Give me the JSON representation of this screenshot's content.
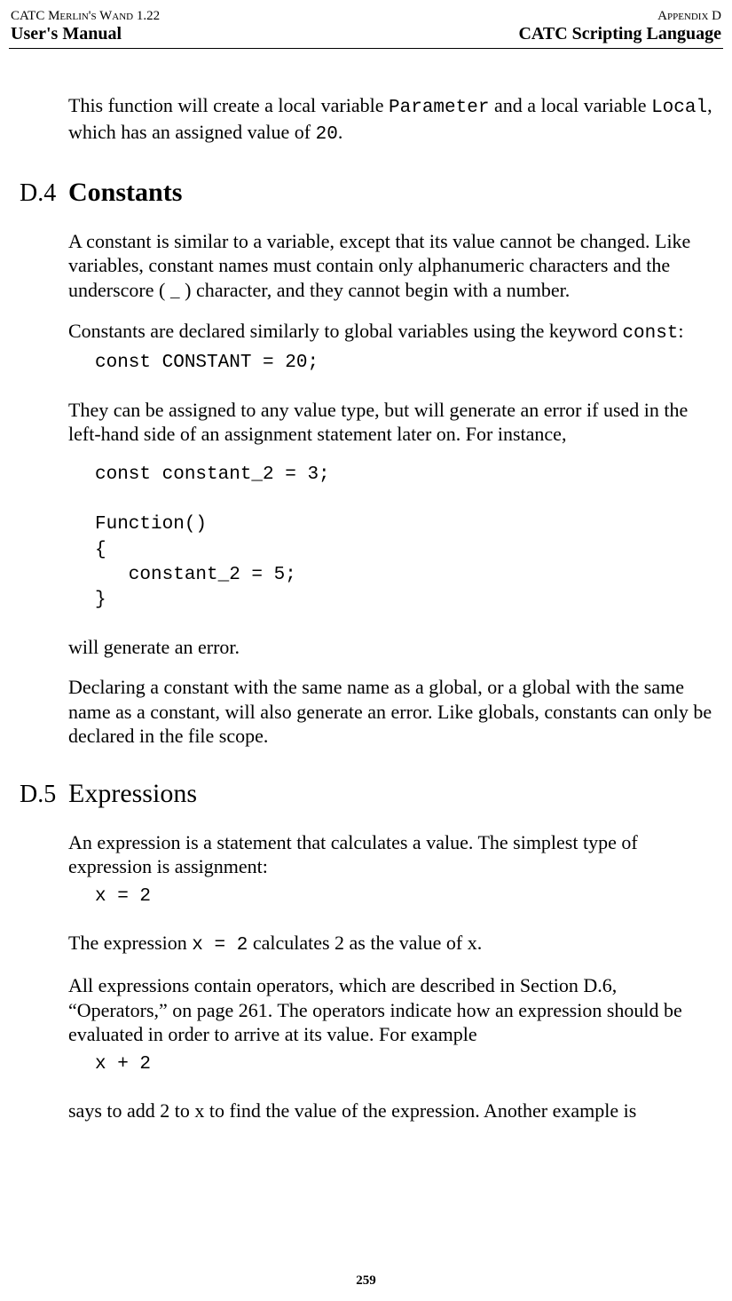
{
  "header": {
    "top_left": "CATC Merlin's Wand 1.22",
    "top_right": "Appendix D",
    "bottom_left": "User's Manual",
    "bottom_right": "CATC Scripting Language"
  },
  "intro": {
    "p1_a": "This function will create a local variable ",
    "p1_code1": "Parameter",
    "p1_b": " and a local variable ",
    "p1_code2": "Local",
    "p1_c": ", which has an assigned value of ",
    "p1_code3": "20",
    "p1_d": "."
  },
  "d4": {
    "number": "D.4",
    "title": "Constants",
    "p1_a": "A constant is similar to a variable, except that its value cannot be changed. Like variables, constant names must contain only alphanumeric characters and the underscore ( ",
    "p1_under": "_",
    "p1_b": " ) character, and they cannot begin with a number.",
    "p2_a": "Constants are declared similarly to global variables using the keyword ",
    "p2_code": "const",
    "p2_b": ":",
    "code1": "const CONSTANT = 20;",
    "p3": "They can be assigned to any value type, but will generate an error if used in the left-hand side of an assignment statement later on. For instance,",
    "code2": "const constant_2 = 3;\n\nFunction()\n{\n   constant_2 = 5;\n}",
    "p4": "will generate an error.",
    "p5": "Declaring a constant with the same name as a global, or a global with the same name as a constant, will also generate an error. Like globals, constants can only be declared in the file scope."
  },
  "d5": {
    "number": "D.5",
    "title": "Expressions",
    "p1": "An expression is a statement that calculates a value. The simplest type of expression is assignment:",
    "code1": "x = 2",
    "p2_a": "The expression ",
    "p2_code": "x = 2",
    "p2_b": " calculates 2 as the value of x.",
    "p3": "All expressions contain operators, which are described in Section D.6, “Operators,” on page 261. The operators indicate how an expression should be evaluated in order to arrive at its value. For example",
    "code2": "x + 2",
    "p4": "says to add 2 to x to find the value of the expression. Another example is"
  },
  "footer": {
    "page_number": "259"
  }
}
